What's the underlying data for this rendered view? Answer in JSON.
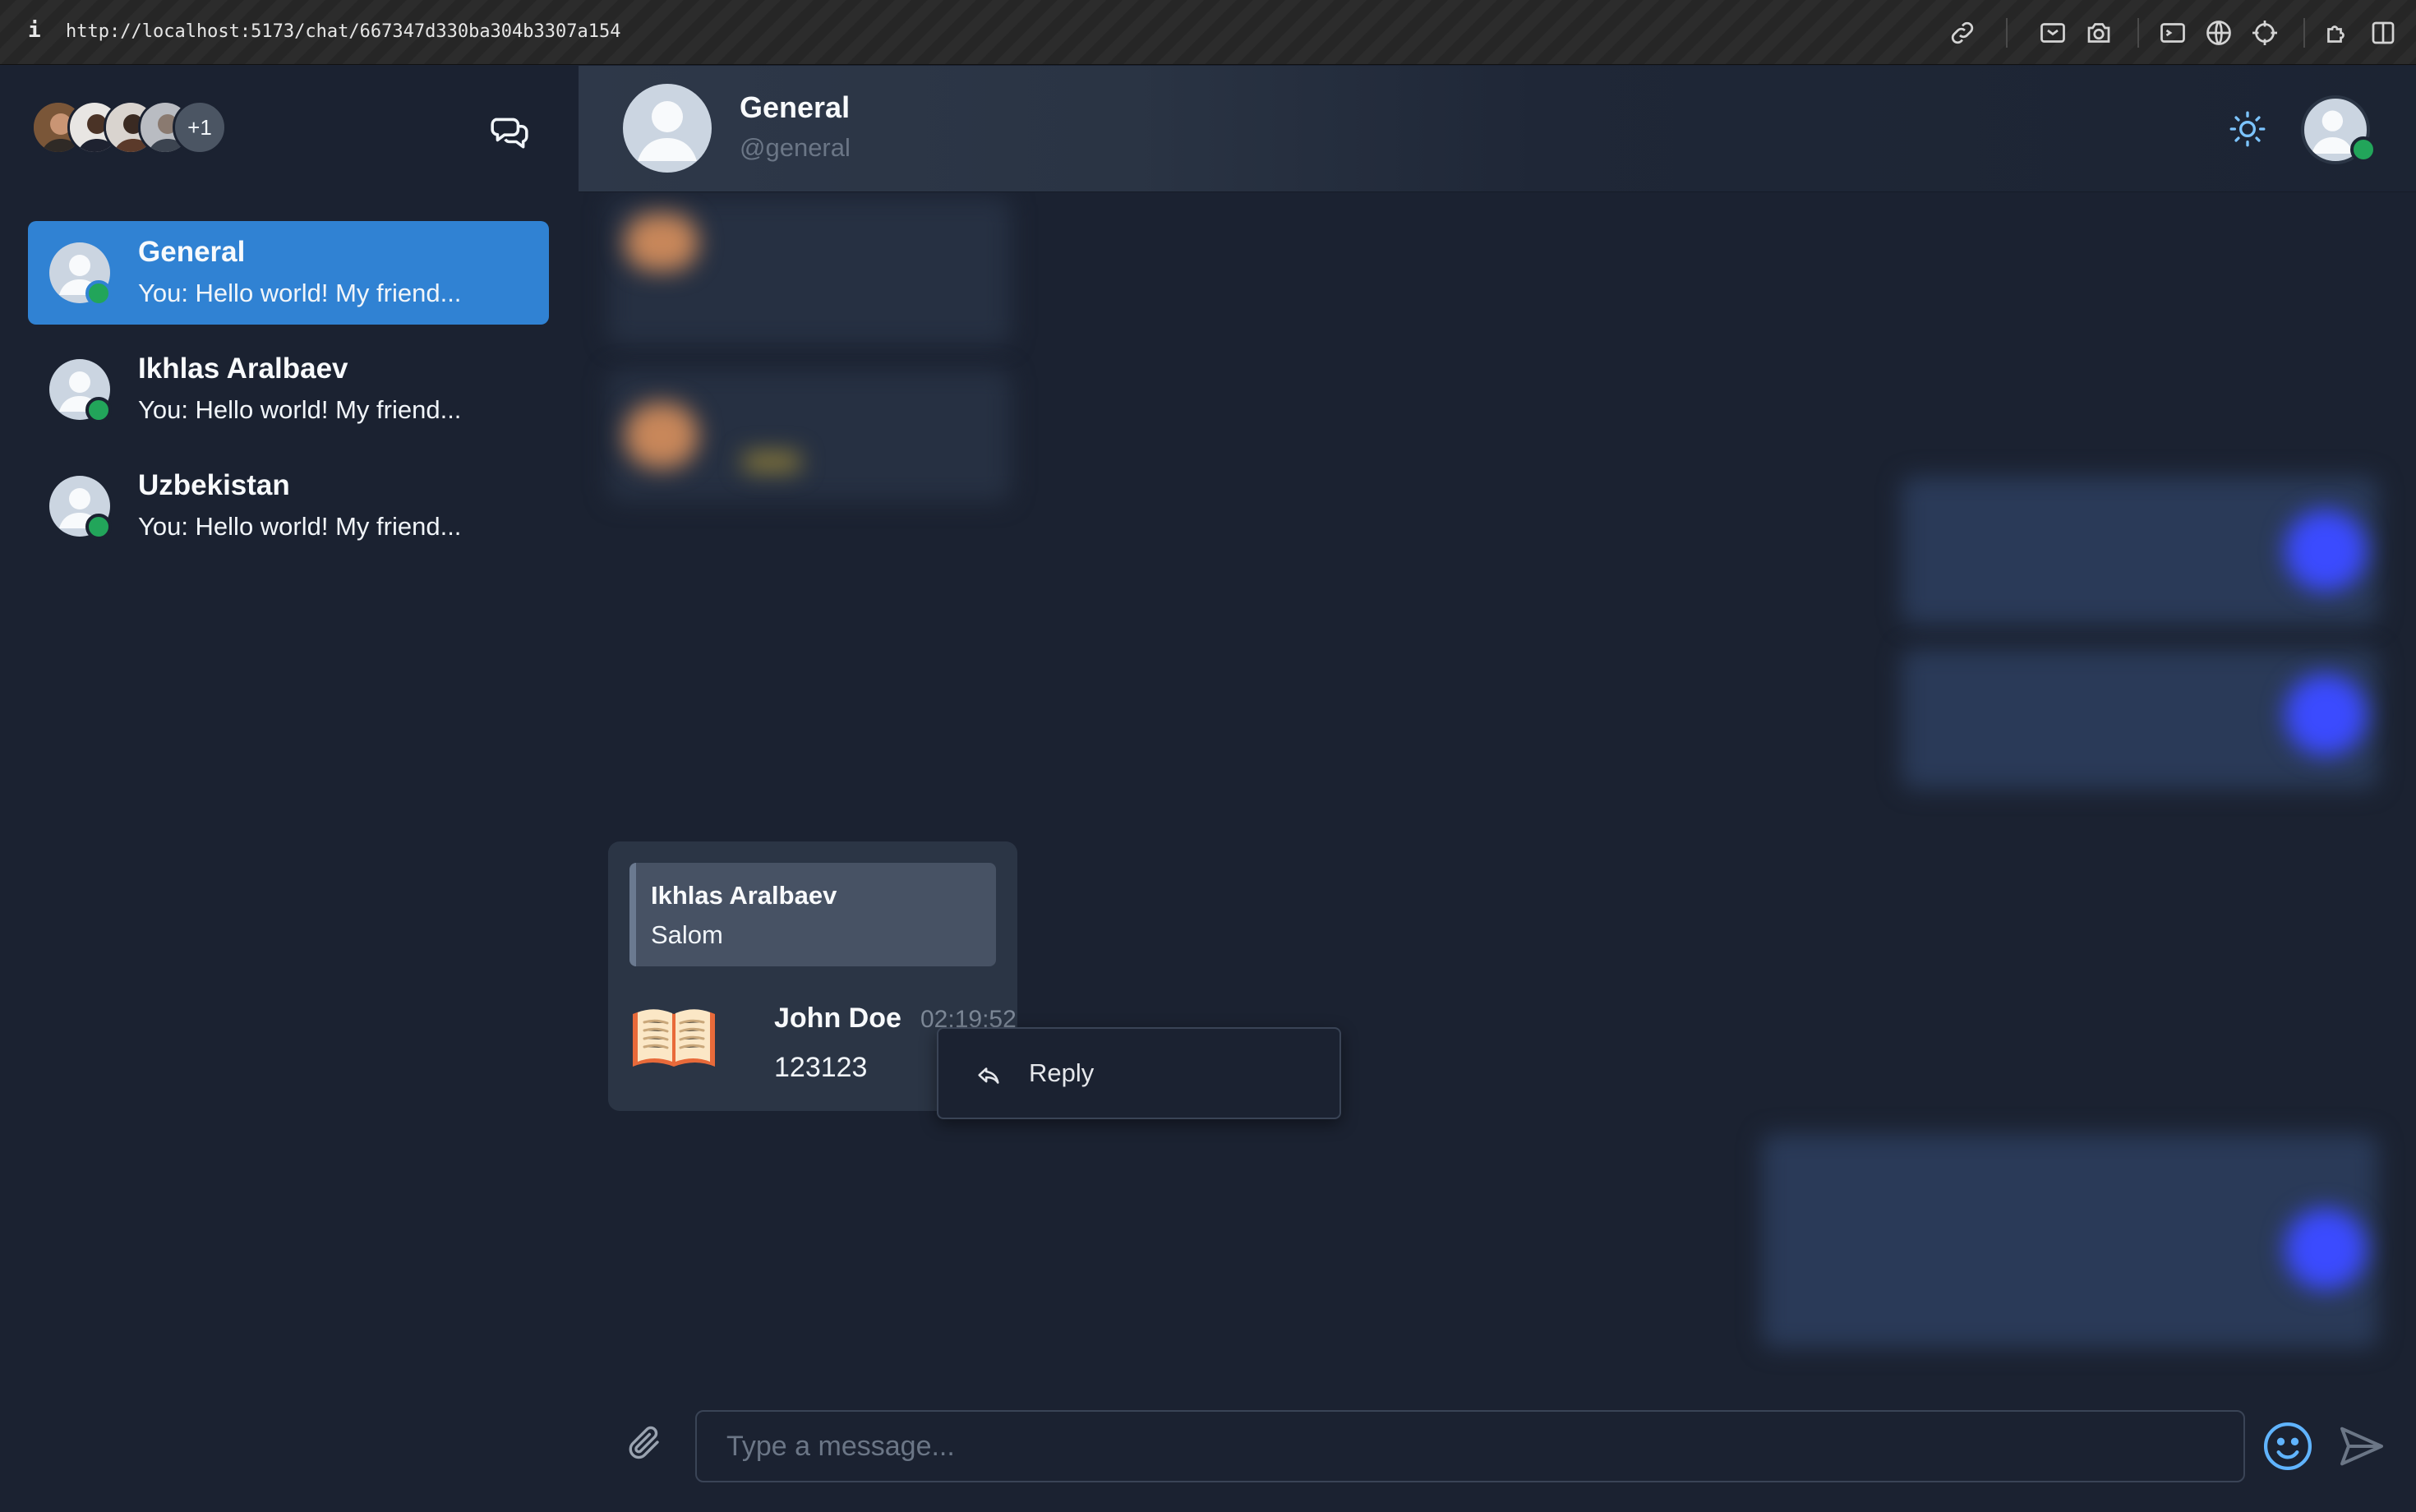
{
  "browser": {
    "url": "http://localhost:5173/chat/667347d330ba304b3307a154",
    "info_glyph": "i",
    "toolbar_icons": [
      "link-icon",
      "screenshot-icon",
      "camera-icon",
      "terminal-icon",
      "globe-icon",
      "crosshair-icon",
      "extension-icon",
      "sidebar-toggle-icon"
    ]
  },
  "sidebar": {
    "participants_more": "+1",
    "chats": [
      {
        "name": "General",
        "preview": "You: Hello world! My friend...",
        "active": true
      },
      {
        "name": "Ikhlas Aralbaev",
        "preview": "You: Hello world! My friend...",
        "active": false
      },
      {
        "name": "Uzbekistan",
        "preview": "You: Hello world! My friend...",
        "active": false
      }
    ]
  },
  "header": {
    "title": "General",
    "handle": "@general"
  },
  "message": {
    "reply_to": {
      "name": "Ikhlas Aralbaev",
      "text": "Salom"
    },
    "author": "John Doe",
    "time": "02:19:52",
    "text": "123123"
  },
  "context_menu": {
    "items": [
      {
        "label": "Reply",
        "icon": "reply-icon"
      }
    ]
  },
  "composer": {
    "placeholder": "Type a message..."
  },
  "colors": {
    "background": "#1b2231",
    "active_chat": "#3082d3",
    "online": "#22a55a",
    "sent_bubble_accent": "#3b4bff"
  }
}
